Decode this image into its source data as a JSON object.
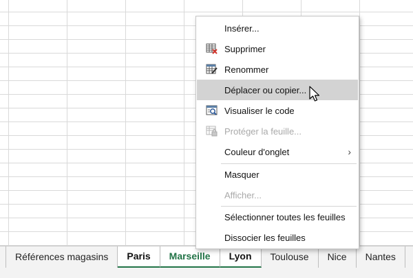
{
  "menu": {
    "items": [
      {
        "label": "Insérer...",
        "icon": "none"
      },
      {
        "label": "Supprimer",
        "icon": "delete-sheet-icon"
      },
      {
        "label": "Renommer",
        "icon": "rename-sheet-icon"
      },
      {
        "label": "Déplacer ou copier...",
        "icon": "none",
        "state": "highlighted"
      },
      {
        "label": "Visualiser le code",
        "icon": "view-code-icon"
      },
      {
        "label": "Protéger la feuille...",
        "icon": "protect-sheet-icon",
        "state": "disabled"
      },
      {
        "label": "Couleur d'onglet",
        "icon": "none",
        "submenu": true
      },
      {
        "label": "Masquer",
        "icon": "none"
      },
      {
        "label": "Afficher...",
        "icon": "none",
        "state": "disabled"
      },
      {
        "label": "Sélectionner toutes les feuilles",
        "icon": "none"
      },
      {
        "label": "Dissocier les feuilles",
        "icon": "none"
      }
    ],
    "submenu_arrow": "›"
  },
  "sheet_tabs": [
    {
      "label": "Références magasins",
      "selected": false
    },
    {
      "label": "Paris",
      "selected": true
    },
    {
      "label": "Marseille",
      "selected": true,
      "color": "#217346"
    },
    {
      "label": "Lyon",
      "selected": true
    },
    {
      "label": "Toulouse",
      "selected": false
    },
    {
      "label": "Nice",
      "selected": false
    },
    {
      "label": "Nantes",
      "selected": false
    }
  ],
  "colors": {
    "accent": "#217346",
    "highlight": "#d3d3d3",
    "disabled_text": "#a9a9a9",
    "delete_icon": "#d0342c"
  }
}
